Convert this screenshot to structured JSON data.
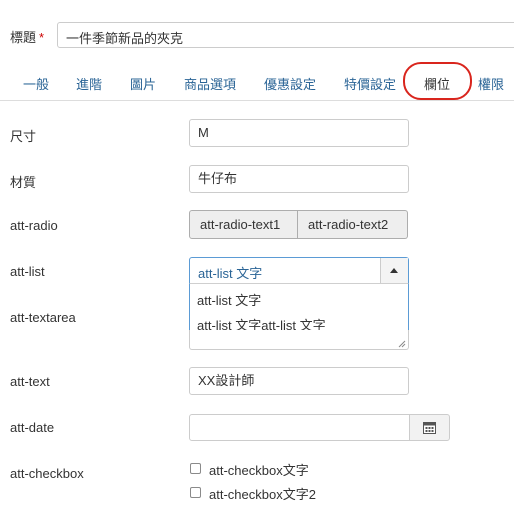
{
  "title_field": {
    "label": "標題",
    "required_mark": "*",
    "value": "一件季節新品的夾克"
  },
  "tabs": [
    {
      "label": "一般"
    },
    {
      "label": "進階"
    },
    {
      "label": "圖片"
    },
    {
      "label": "商品選項"
    },
    {
      "label": "優惠設定"
    },
    {
      "label": "特價設定"
    },
    {
      "label": "欄位"
    },
    {
      "label": "權限"
    }
  ],
  "active_tab": "欄位",
  "fields": {
    "size": {
      "label": "尺寸",
      "value": "M"
    },
    "material": {
      "label": "材質",
      "value": "牛仔布"
    },
    "radio": {
      "label": "att-radio",
      "options": [
        "att-radio-text1",
        "att-radio-text2"
      ]
    },
    "list": {
      "label": "att-list",
      "selected": "att-list 文字",
      "options": [
        "att-list 文字",
        "att-list 文字att-list 文字"
      ]
    },
    "textarea": {
      "label": "att-textarea"
    },
    "text": {
      "label": "att-text",
      "value": "XX設計師"
    },
    "date": {
      "label": "att-date",
      "value": ""
    },
    "checkbox": {
      "label": "att-checkbox",
      "options": [
        "att-checkbox文字",
        "att-checkbox文字2"
      ]
    }
  },
  "icons": {
    "calendar": "calendar-icon",
    "dropdown": "chevron-up-icon"
  },
  "colors": {
    "link": "#2a6496",
    "highlight": "#d9251d",
    "focus": "#5b9bd5"
  }
}
